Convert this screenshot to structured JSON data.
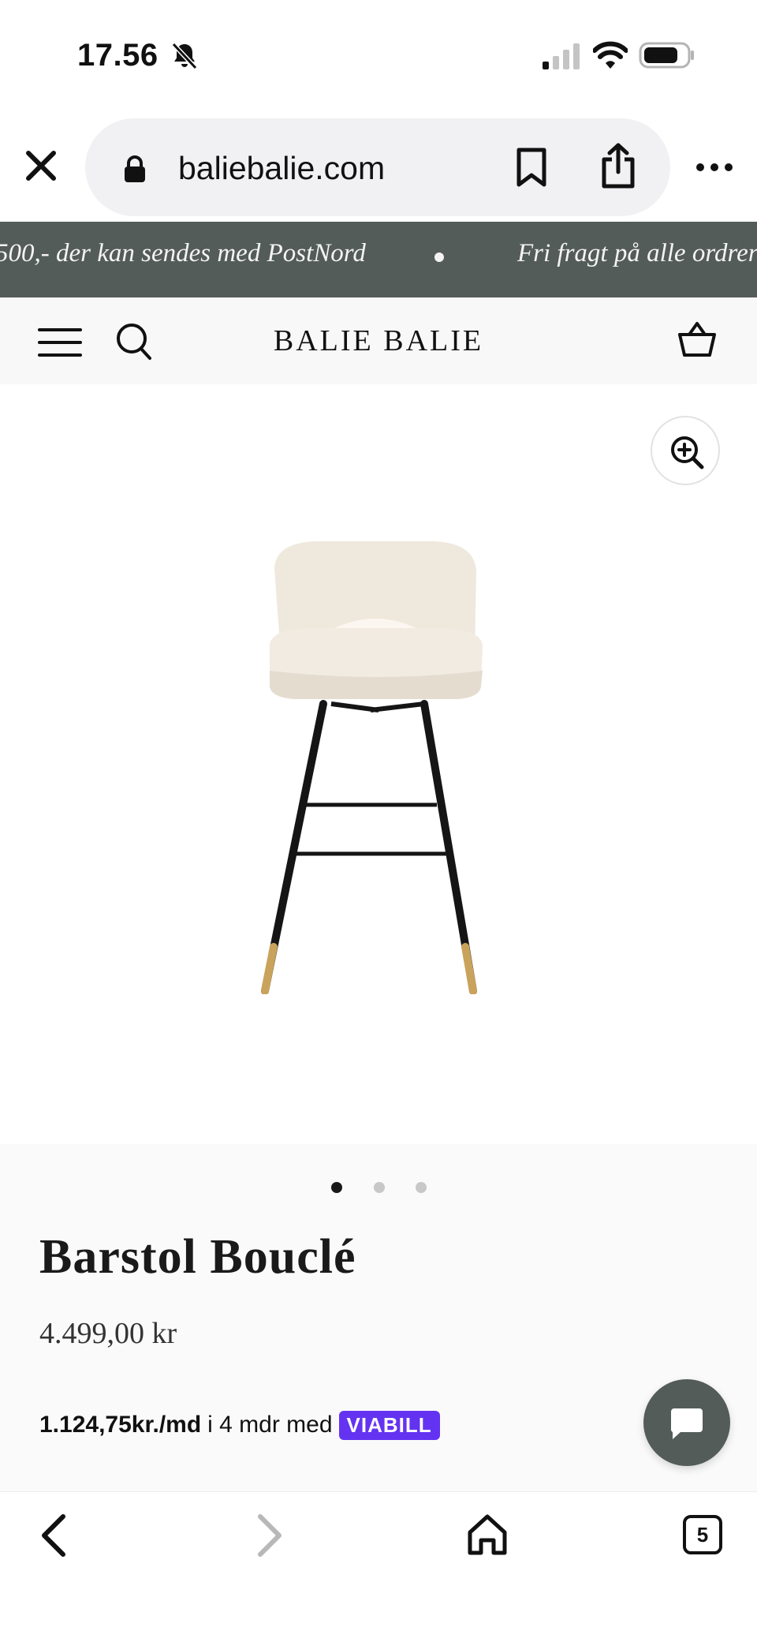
{
  "status_bar": {
    "time": "17.56",
    "icons": [
      "bell-slash-icon",
      "signal-icon",
      "wifi-icon",
      "battery-icon"
    ]
  },
  "browser": {
    "url": "baliebalie.com",
    "icons": [
      "close-icon",
      "lock-icon",
      "bookmark-icon",
      "share-icon",
      "more-icon"
    ]
  },
  "announcement": {
    "text_1": "500,- der kan sendes med PostNord",
    "text_2": "Fri fragt på alle ordrer",
    "background_color": "#545c5a"
  },
  "store_header": {
    "logo": "BALIE BALIE",
    "icons": [
      "menu-icon",
      "search-icon",
      "cart-icon"
    ]
  },
  "product": {
    "title": "Barstol Bouclé",
    "price": "4.499,00 kr",
    "image_description_icon": "barstool-image",
    "carousel": {
      "count": 3,
      "active_index": 0
    },
    "installment": {
      "amount": "1.124,75kr./md",
      "rest": "i 4 mdr med",
      "provider": "VIABILL",
      "provider_color": "#6433f2"
    }
  },
  "chat": {
    "icon": "chat-bubble-icon",
    "color": "#545c5a"
  },
  "bottom_toolbar": {
    "tab_count": "5",
    "icons": [
      "back-icon",
      "forward-icon",
      "home-icon",
      "tabs-icon"
    ]
  }
}
